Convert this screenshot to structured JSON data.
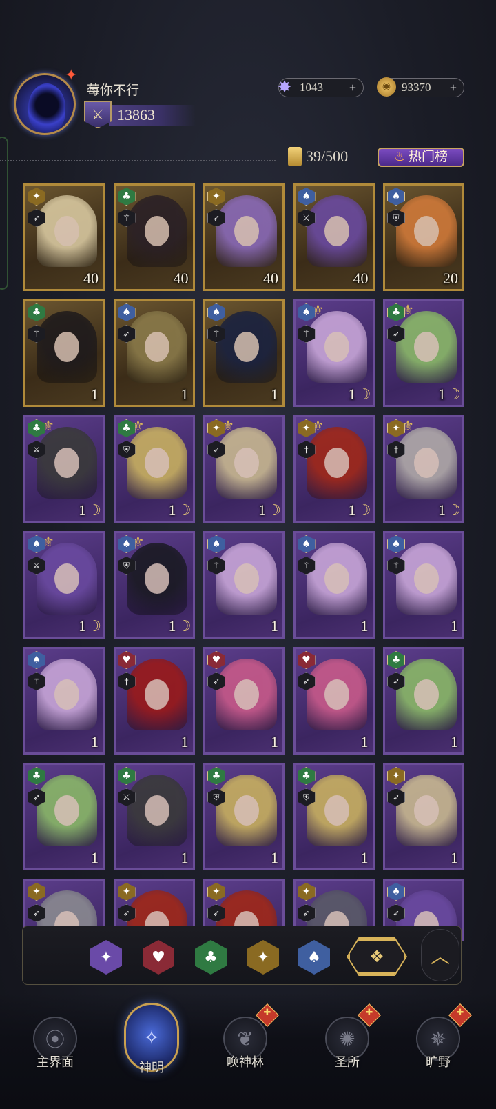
{
  "header": {
    "player_name": "莓你不行",
    "power": "13863",
    "stars": "1043",
    "gold": "93370",
    "plus": "+",
    "card_count": "39/500",
    "hot_button": "热门榜"
  },
  "colors": {
    "accent_gold": "#d9b45a",
    "purple_card": "#5b3d8a",
    "gold_card": "#6b5630"
  },
  "cards": [
    {
      "frame": "gold",
      "suit": "star",
      "cls": "bow",
      "level": "40",
      "art": "#d8c8a0"
    },
    {
      "frame": "gold",
      "suit": "club",
      "cls": "scepter",
      "level": "40",
      "art": "#2a2026"
    },
    {
      "frame": "gold",
      "suit": "star",
      "cls": "bow",
      "level": "40",
      "art": "#8a6ab8"
    },
    {
      "frame": "gold",
      "suit": "spade",
      "cls": "sword",
      "level": "40",
      "art": "#6a4aa0"
    },
    {
      "frame": "gold",
      "suit": "spade",
      "cls": "shield",
      "level": "20",
      "art": "#d07a3a"
    },
    {
      "frame": "gold",
      "suit": "club",
      "cls": "scepter",
      "level": "1",
      "art": "#1e1a1c"
    },
    {
      "frame": "gold",
      "suit": "spade",
      "cls": "bow",
      "level": "1",
      "art": "#8a7a4a"
    },
    {
      "frame": "gold",
      "suit": "spade",
      "cls": "scepter",
      "level": "1",
      "art": "#1a2240"
    },
    {
      "frame": "purple",
      "suit": "spade",
      "cls": "scepter",
      "level": "1",
      "art": "#c8a6d8"
    },
    {
      "frame": "purple",
      "suit": "club",
      "cls": "bow",
      "level": "1",
      "art": "#8ab868"
    },
    {
      "frame": "purple",
      "suit": "club",
      "cls": "sword",
      "level": "1",
      "art": "#3a3a3a"
    },
    {
      "frame": "purple",
      "suit": "club",
      "cls": "shield",
      "level": "1",
      "art": "#c8b060"
    },
    {
      "frame": "purple",
      "suit": "star",
      "cls": "bow",
      "level": "1",
      "art": "#c8b890"
    },
    {
      "frame": "purple",
      "suit": "star",
      "cls": "dagger",
      "level": "1",
      "art": "#a02818"
    },
    {
      "frame": "purple",
      "suit": "star",
      "cls": "dagger",
      "level": "1",
      "art": "#b0aaa8"
    },
    {
      "frame": "purple",
      "suit": "spade",
      "cls": "sword",
      "level": "1",
      "art": "#6a4aa0"
    },
    {
      "frame": "purple",
      "suit": "spade",
      "cls": "shield",
      "level": "1",
      "art": "#1a1a22"
    },
    {
      "frame": "purple",
      "suit": "spade",
      "cls": "scepter",
      "level": "1",
      "art": "#c8a6d8"
    },
    {
      "frame": "purple",
      "suit": "spade",
      "cls": "scepter",
      "level": "1",
      "art": "#c8a6d8"
    },
    {
      "frame": "purple",
      "suit": "spade",
      "cls": "scepter",
      "level": "1",
      "art": "#c8a6d8"
    },
    {
      "frame": "purple",
      "suit": "spade",
      "cls": "scepter",
      "level": "1",
      "art": "#c8a6d8"
    },
    {
      "frame": "purple",
      "suit": "heart",
      "cls": "dagger",
      "level": "1",
      "art": "#9a1a1a"
    },
    {
      "frame": "purple",
      "suit": "heart",
      "cls": "bow",
      "level": "1",
      "art": "#c85a8a"
    },
    {
      "frame": "purple",
      "suit": "heart",
      "cls": "bow",
      "level": "1",
      "art": "#c85a8a"
    },
    {
      "frame": "purple",
      "suit": "club",
      "cls": "bow",
      "level": "1",
      "art": "#8ab868"
    },
    {
      "frame": "purple",
      "suit": "club",
      "cls": "bow",
      "level": "1",
      "art": "#8ab868"
    },
    {
      "frame": "purple",
      "suit": "club",
      "cls": "sword",
      "level": "1",
      "art": "#3a3a3a"
    },
    {
      "frame": "purple",
      "suit": "club",
      "cls": "shield",
      "level": "1",
      "art": "#c8b060"
    },
    {
      "frame": "purple",
      "suit": "club",
      "cls": "shield",
      "level": "1",
      "art": "#c8b060"
    },
    {
      "frame": "purple",
      "suit": "star",
      "cls": "bow",
      "level": "1",
      "art": "#c8b890"
    },
    {
      "frame": "purple",
      "suit": "star",
      "cls": "bow",
      "level": "",
      "art": "#8a8a90"
    },
    {
      "frame": "purple",
      "suit": "star",
      "cls": "bow",
      "level": "",
      "art": "#a02818"
    },
    {
      "frame": "purple",
      "suit": "star",
      "cls": "bow",
      "level": "",
      "art": "#a02818"
    },
    {
      "frame": "purple",
      "suit": "star",
      "cls": "bow",
      "level": "",
      "art": "#5a5a68"
    },
    {
      "frame": "purple",
      "suit": "spade",
      "cls": "bow",
      "level": "",
      "art": "#6a4aa0"
    }
  ],
  "moon_badges": [
    8,
    9,
    10,
    11,
    12,
    13,
    14,
    15,
    16
  ],
  "icons": {
    "star": "✦",
    "club": "♣",
    "spade": "♠",
    "heart": "♥",
    "bow": "➶",
    "scepter": "⚚",
    "sword": "⚔",
    "shield": "⛨",
    "dagger": "†",
    "moon": "☽",
    "crest": "⚜"
  },
  "filters": [
    {
      "name": "filter-star",
      "glyph": "✦"
    },
    {
      "name": "filter-heart",
      "glyph": "♥"
    },
    {
      "name": "filter-club",
      "glyph": "♣"
    },
    {
      "name": "filter-gold",
      "glyph": "✦"
    },
    {
      "name": "filter-spade",
      "glyph": "♠"
    }
  ],
  "filter_all_glyph": "❖",
  "collapse_glyph": "︿",
  "nav": [
    {
      "label": "主界面",
      "glyph": "⦿",
      "gift": false
    },
    {
      "label": "神明",
      "glyph": "✧",
      "gift": false,
      "active": true
    },
    {
      "label": "唤神林",
      "glyph": "❦",
      "gift": true
    },
    {
      "label": "圣所",
      "glyph": "✺",
      "gift": true
    },
    {
      "label": "旷野",
      "glyph": "✵",
      "gift": true
    }
  ],
  "gift_glyph": "✚"
}
